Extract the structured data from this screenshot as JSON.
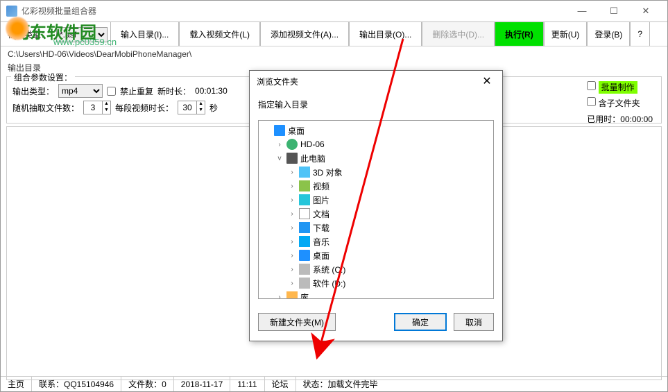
{
  "window": {
    "title": "亿彩视频批量组合器"
  },
  "watermark": {
    "brand": "河东软件园",
    "url": "www.pc0359.cn"
  },
  "toolbar": {
    "type_label": "视频类型：",
    "type_value": "*.asf",
    "input_dir": "输入目录(I)...",
    "load_video": "载入视频文件(L)",
    "add_video": "添加视频文件(A)...",
    "output_dir": "输出目录(O)...",
    "delete_sel": "删除选中(D)...",
    "execute": "执行(R)",
    "update": "更新(U)",
    "login": "登录(B)",
    "help": "?"
  },
  "path": "C:\\Users\\HD-06\\Videos\\DearMobiPhoneManager\\",
  "section_label": "输出目录",
  "params": {
    "title": "组合参数设置：",
    "output_type_label": "输出类型：",
    "output_type_value": "mp4",
    "no_repeat": "禁止重复",
    "new_duration_label": "新时长：",
    "new_duration_value": "00:01:30",
    "random_count_label": "随机抽取文件数：",
    "random_count_value": "3",
    "segment_duration_label": "每段视频时长：",
    "segment_duration_value": "30",
    "seconds": "秒",
    "batch_make": "批量制作",
    "subfolders": "含子文件夹",
    "elapsed_label": "已用时：",
    "elapsed_value": "00:00:00"
  },
  "dialog": {
    "title": "浏览文件夹",
    "prompt": "指定输入目录",
    "tree": [
      {
        "label": "桌面",
        "icon": "desktop",
        "indent": 0,
        "toggle": ""
      },
      {
        "label": "HD-06",
        "icon": "user",
        "indent": 1,
        "toggle": "›"
      },
      {
        "label": "此电脑",
        "icon": "pc",
        "indent": 1,
        "toggle": "v"
      },
      {
        "label": "3D 对象",
        "icon": "3d",
        "indent": 2,
        "toggle": "›"
      },
      {
        "label": "视频",
        "icon": "video",
        "indent": 2,
        "toggle": "›"
      },
      {
        "label": "图片",
        "icon": "pic",
        "indent": 2,
        "toggle": "›"
      },
      {
        "label": "文档",
        "icon": "doc",
        "indent": 2,
        "toggle": "›"
      },
      {
        "label": "下载",
        "icon": "dl",
        "indent": 2,
        "toggle": "›"
      },
      {
        "label": "音乐",
        "icon": "music",
        "indent": 2,
        "toggle": "›"
      },
      {
        "label": "桌面",
        "icon": "desktop",
        "indent": 2,
        "toggle": "›"
      },
      {
        "label": "系统 (C:)",
        "icon": "drive",
        "indent": 2,
        "toggle": "›"
      },
      {
        "label": "软件 (D:)",
        "icon": "drive",
        "indent": 2,
        "toggle": "›"
      },
      {
        "label": "库",
        "icon": "lib",
        "indent": 1,
        "toggle": "›"
      }
    ],
    "new_folder": "新建文件夹(M)",
    "ok": "确定",
    "cancel": "取消"
  },
  "status": {
    "home": "主页",
    "contact": "联系：QQ15104946",
    "file_count": "文件数：0",
    "date": "2018-11-17",
    "time": "11:11",
    "forum": "论坛",
    "state": "状态：加载文件完毕"
  }
}
